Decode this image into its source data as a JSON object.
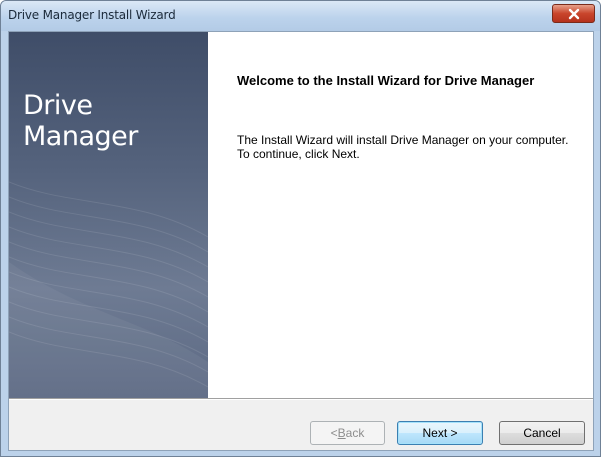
{
  "window": {
    "title": "Drive Manager Install Wizard",
    "close_icon": "close-icon"
  },
  "side_panel": {
    "brand_text": "Drive Manager"
  },
  "content": {
    "heading": "Welcome to the Install Wizard for Drive Manager",
    "body_line1": "The Install Wizard will install Drive Manager on your computer.",
    "body_line2": "To continue, click Next."
  },
  "buttons": {
    "back_label_prefix": "< ",
    "back_label_accel": "B",
    "back_label_rest": "ack",
    "back_enabled": false,
    "next_label": "Next >",
    "cancel_label": "Cancel"
  },
  "colors": {
    "title_bar": "#bcd3ec",
    "side_panel": "#55637d",
    "close_button": "#c9452c"
  }
}
